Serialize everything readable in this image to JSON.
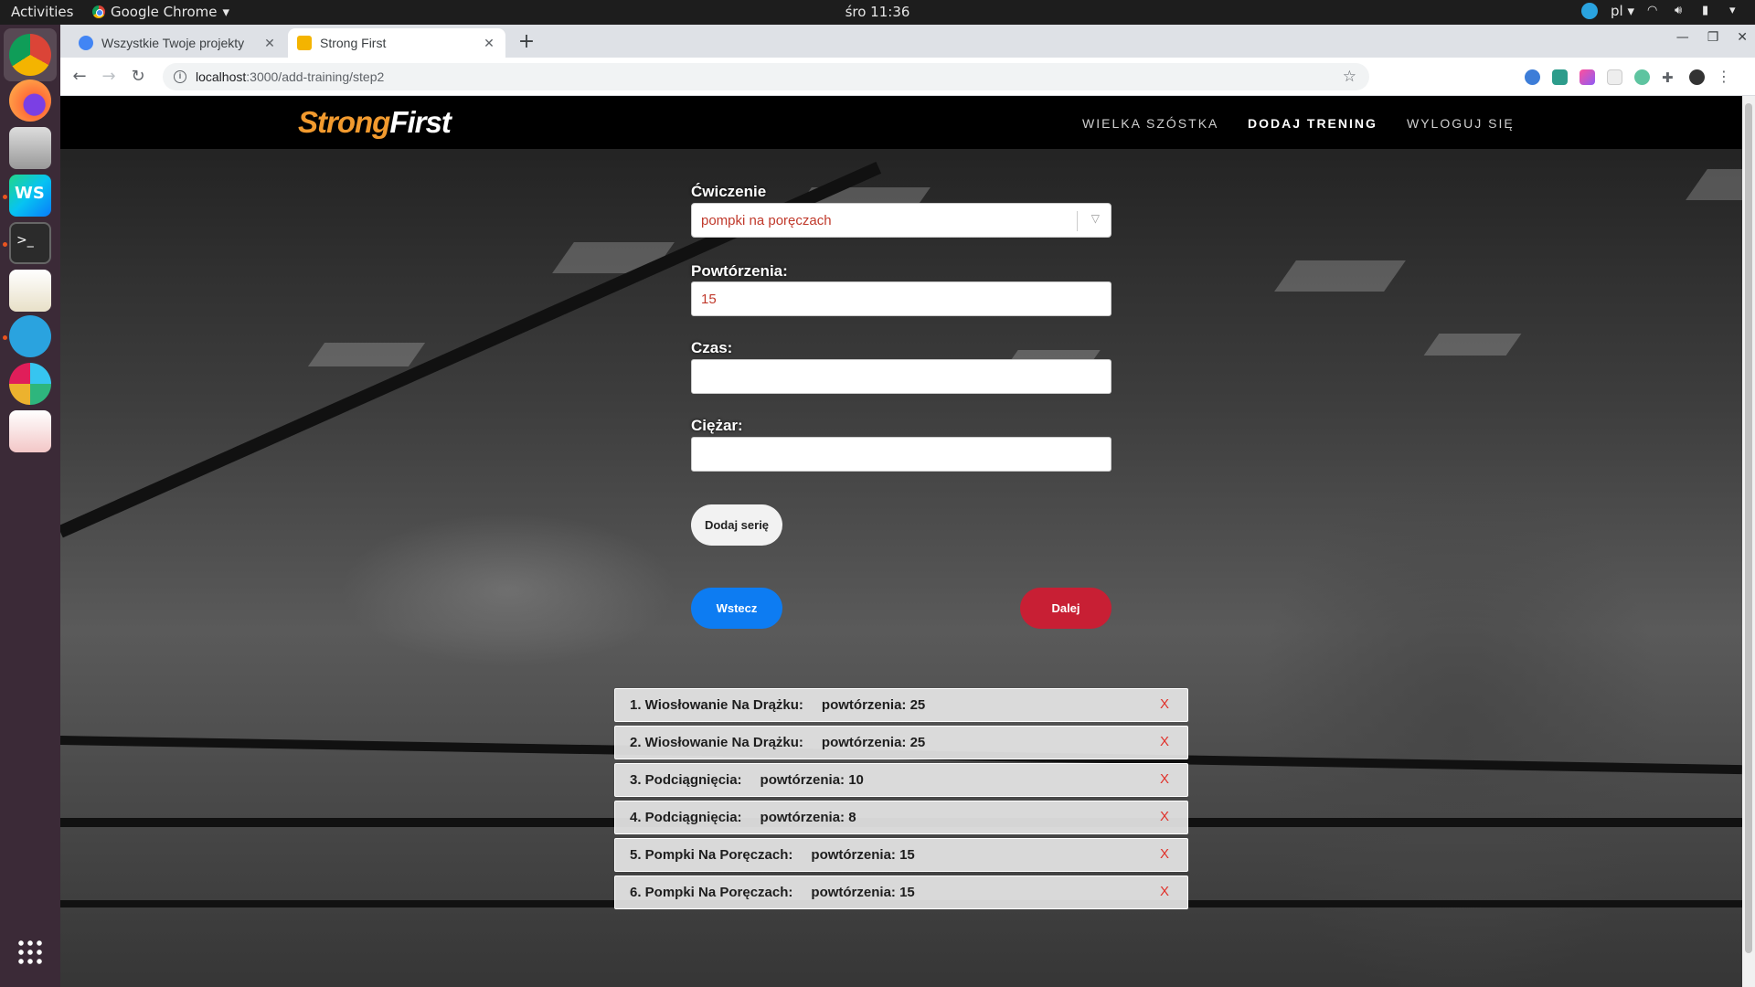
{
  "system": {
    "activities": "Activities",
    "app_name": "Google Chrome",
    "clock": "śro 11:36",
    "language": "pl"
  },
  "browser": {
    "tabs": [
      {
        "title": "Wszystkie Twoje projekty",
        "active": false
      },
      {
        "title": "Strong First",
        "active": true
      }
    ],
    "url_host": "localhost",
    "url_path": ":3000/add-training/step2"
  },
  "site": {
    "logo_part1": "Strong",
    "logo_part2": "First",
    "nav": [
      {
        "label": "WIELKA SZÓSTKA",
        "current": false
      },
      {
        "label": "DODAJ TRENING",
        "current": true
      },
      {
        "label": "WYLOGUJ SIĘ",
        "current": false
      }
    ]
  },
  "form": {
    "exercise_label": "Ćwiczenie",
    "exercise_value": "pompki na poręczach",
    "reps_label": "Powtórzenia:",
    "reps_value": "15",
    "time_label": "Czas:",
    "time_value": "",
    "weight_label": "Ciężar:",
    "weight_value": "",
    "add_series_label": "Dodaj serię",
    "back_label": "Wstecz",
    "next_label": "Dalej"
  },
  "series": [
    {
      "name": "1. Wiosłowanie Na Drążku:",
      "reps": "powtórzenia: 25",
      "delete": "X"
    },
    {
      "name": "2. Wiosłowanie Na Drążku:",
      "reps": "powtórzenia: 25",
      "delete": "X"
    },
    {
      "name": "3. Podciągnięcia:",
      "reps": "powtórzenia: 10",
      "delete": "X"
    },
    {
      "name": "4. Podciągnięcia:",
      "reps": "powtórzenia: 8",
      "delete": "X"
    },
    {
      "name": "5. Pompki Na Poręczach:",
      "reps": "powtórzenia: 15",
      "delete": "X"
    },
    {
      "name": "6. Pompki Na Poręczach:",
      "reps": "powtórzenia: 15",
      "delete": "X"
    }
  ]
}
